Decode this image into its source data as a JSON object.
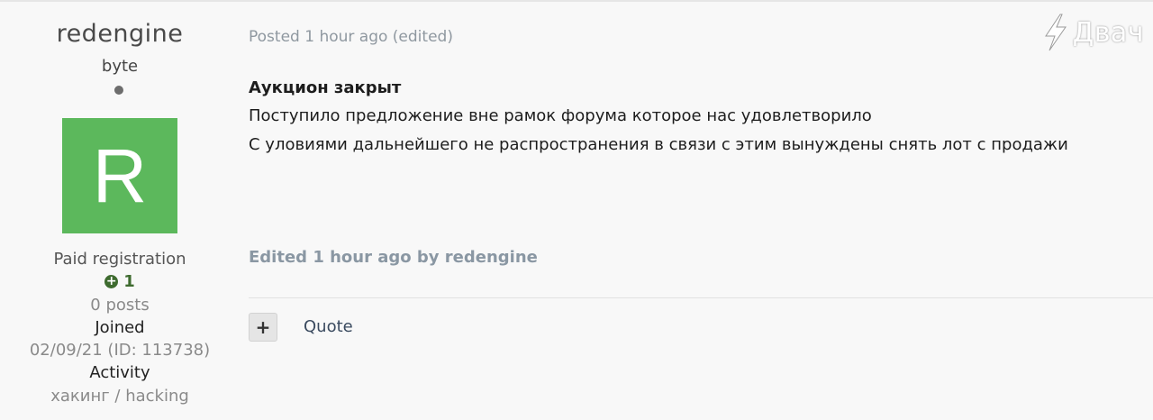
{
  "author": {
    "username": "redengine",
    "rank": "byte",
    "avatar_letter": "R",
    "avatar_color": "#5cb85c",
    "group": "Paid registration",
    "reputation": "1",
    "posts": "0 posts",
    "joined_label": "Joined",
    "joined_value": "02/09/21 (ID: 113738)",
    "activity_label": "Activity",
    "activity_value": "хакинг / hacking"
  },
  "post": {
    "meta": "Posted 1 hour ago (edited)",
    "title": "Аукцион закрыт",
    "lines": [
      "Поступило предложение вне рамок форума которое нас удовлетворило",
      "С уловиями дальнейшего не распространения в связи с этим вынуждены снять лот с продажи"
    ],
    "edited_note": "Edited 1 hour ago by redengine"
  },
  "actions": {
    "plus_label": "+",
    "quote_label": "Quote"
  },
  "watermark": {
    "text": "Двач"
  }
}
